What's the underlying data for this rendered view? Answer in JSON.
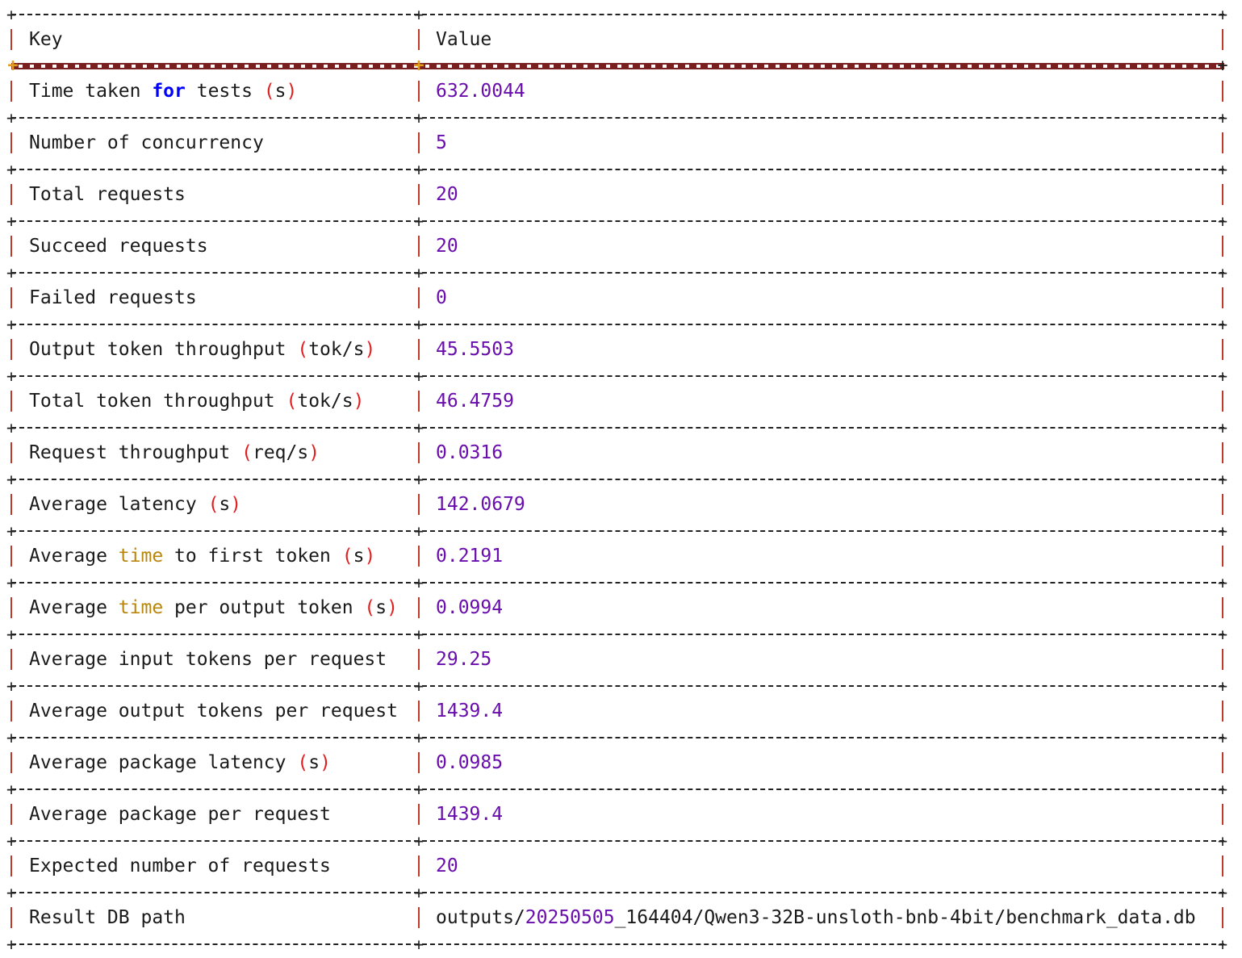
{
  "colors": {
    "border": "#c0392b",
    "dash": "#222222",
    "header_separator": "#7a1f1f",
    "header_plus": "#e29c1c",
    "number": "#6a0dad",
    "keyword_for": "#0000ff",
    "keyword_time": "#b8860b",
    "paren": "#e02020"
  },
  "header": {
    "key": "Key",
    "value": "Value"
  },
  "rows": [
    {
      "key": [
        {
          "t": "Time taken ",
          "c": "plain"
        },
        {
          "t": "for",
          "c": "kw-blue"
        },
        {
          "t": " tests ",
          "c": "plain"
        },
        {
          "t": "(",
          "c": "paren"
        },
        {
          "t": "s",
          "c": "plain"
        },
        {
          "t": ")",
          "c": "paren"
        }
      ],
      "value": [
        {
          "t": "632.0044",
          "c": "num"
        }
      ]
    },
    {
      "key": [
        {
          "t": "Number of concurrency",
          "c": "plain"
        }
      ],
      "value": [
        {
          "t": "5",
          "c": "num"
        }
      ]
    },
    {
      "key": [
        {
          "t": "Total requests",
          "c": "plain"
        }
      ],
      "value": [
        {
          "t": "20",
          "c": "num"
        }
      ]
    },
    {
      "key": [
        {
          "t": "Succeed requests",
          "c": "plain"
        }
      ],
      "value": [
        {
          "t": "20",
          "c": "num"
        }
      ]
    },
    {
      "key": [
        {
          "t": "Failed requests",
          "c": "plain"
        }
      ],
      "value": [
        {
          "t": "0",
          "c": "num"
        }
      ]
    },
    {
      "key": [
        {
          "t": "Output token throughput ",
          "c": "plain"
        },
        {
          "t": "(",
          "c": "paren"
        },
        {
          "t": "tok/s",
          "c": "plain"
        },
        {
          "t": ")",
          "c": "paren"
        }
      ],
      "value": [
        {
          "t": "45.5503",
          "c": "num"
        }
      ]
    },
    {
      "key": [
        {
          "t": "Total token throughput ",
          "c": "plain"
        },
        {
          "t": "(",
          "c": "paren"
        },
        {
          "t": "tok/s",
          "c": "plain"
        },
        {
          "t": ")",
          "c": "paren"
        }
      ],
      "value": [
        {
          "t": "46.4759",
          "c": "num"
        }
      ]
    },
    {
      "key": [
        {
          "t": "Request throughput ",
          "c": "plain"
        },
        {
          "t": "(",
          "c": "paren"
        },
        {
          "t": "req/s",
          "c": "plain"
        },
        {
          "t": ")",
          "c": "paren"
        }
      ],
      "value": [
        {
          "t": "0.0316",
          "c": "num"
        }
      ]
    },
    {
      "key": [
        {
          "t": "Average latency ",
          "c": "plain"
        },
        {
          "t": "(",
          "c": "paren"
        },
        {
          "t": "s",
          "c": "plain"
        },
        {
          "t": ")",
          "c": "paren"
        }
      ],
      "value": [
        {
          "t": "142.0679",
          "c": "num"
        }
      ]
    },
    {
      "key": [
        {
          "t": "Average ",
          "c": "plain"
        },
        {
          "t": "time",
          "c": "kw-gold"
        },
        {
          "t": " to first token ",
          "c": "plain"
        },
        {
          "t": "(",
          "c": "paren"
        },
        {
          "t": "s",
          "c": "plain"
        },
        {
          "t": ")",
          "c": "paren"
        }
      ],
      "value": [
        {
          "t": "0.2191",
          "c": "num"
        }
      ]
    },
    {
      "key": [
        {
          "t": "Average ",
          "c": "plain"
        },
        {
          "t": "time",
          "c": "kw-gold"
        },
        {
          "t": " per output token ",
          "c": "plain"
        },
        {
          "t": "(",
          "c": "paren"
        },
        {
          "t": "s",
          "c": "plain"
        },
        {
          "t": ")",
          "c": "paren"
        }
      ],
      "value": [
        {
          "t": "0.0994",
          "c": "num"
        }
      ]
    },
    {
      "key": [
        {
          "t": "Average input tokens per request",
          "c": "plain"
        }
      ],
      "value": [
        {
          "t": "29.25",
          "c": "num"
        }
      ]
    },
    {
      "key": [
        {
          "t": "Average output tokens per request",
          "c": "plain"
        }
      ],
      "value": [
        {
          "t": "1439.4",
          "c": "num"
        }
      ]
    },
    {
      "key": [
        {
          "t": "Average package latency ",
          "c": "plain"
        },
        {
          "t": "(",
          "c": "paren"
        },
        {
          "t": "s",
          "c": "plain"
        },
        {
          "t": ")",
          "c": "paren"
        }
      ],
      "value": [
        {
          "t": "0.0985",
          "c": "num"
        }
      ]
    },
    {
      "key": [
        {
          "t": "Average package per request",
          "c": "plain"
        }
      ],
      "value": [
        {
          "t": "1439.4",
          "c": "num"
        }
      ]
    },
    {
      "key": [
        {
          "t": "Expected number of requests",
          "c": "plain"
        }
      ],
      "value": [
        {
          "t": "20",
          "c": "num"
        }
      ]
    },
    {
      "key": [
        {
          "t": "Result DB path",
          "c": "plain"
        }
      ],
      "value": [
        {
          "t": "outputs/",
          "c": "plain"
        },
        {
          "t": "20250505",
          "c": "num"
        },
        {
          "t": "_164404/Qwen3-32B-unsloth-bnb-4bit/benchmark_data.db",
          "c": "plain"
        }
      ]
    }
  ]
}
